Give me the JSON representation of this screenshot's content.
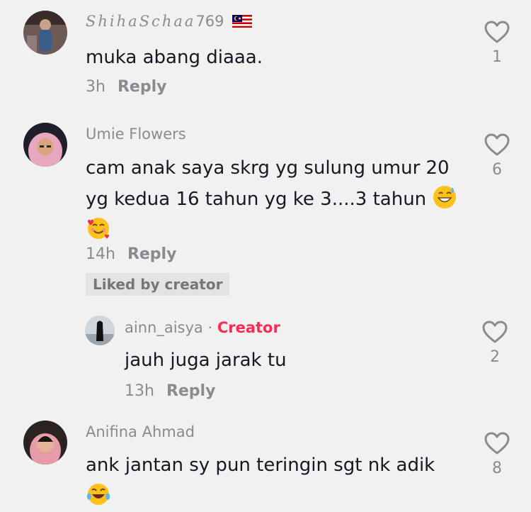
{
  "comments": [
    {
      "username": "ShihaSchaa",
      "username_suffix": "769",
      "text_lines": [
        "muka abang diaaa."
      ],
      "time": "3h",
      "reply_label": "Reply",
      "likes": "1"
    },
    {
      "username": "Umie Flowers",
      "text_lines": [
        "cam anak saya skrg yg sulung umur 20",
        "yg kedua 16 tahun yg ke 3....3 tahun"
      ],
      "time": "14h",
      "reply_label": "Reply",
      "likes": "6",
      "liked_badge": "Liked by creator"
    },
    {
      "username": "ainn_aisya",
      "separator": "·",
      "creator_label": "Creator",
      "text_lines": [
        "jauh juga jarak tu"
      ],
      "time": "13h",
      "reply_label": "Reply",
      "likes": "2"
    },
    {
      "username": "Anifina Ahmad",
      "text_lines": [
        "ank jantan sy pun teringin sgt nk adik"
      ],
      "time": "",
      "likes": "8"
    }
  ],
  "icons": {
    "heart": "heart-outline-icon",
    "flag": "malaysia-flag-icon",
    "emoji_sweat": "grinning-sweat-emoji",
    "emoji_hearts": "smiling-face-with-hearts-emoji",
    "emoji_joy": "tears-of-joy-emoji"
  },
  "colors": {
    "background": "#f1f1f2",
    "text": "#161823",
    "muted": "#8a8b91",
    "creator": "#fe2c55",
    "badge_bg": "#e3e3e4"
  }
}
